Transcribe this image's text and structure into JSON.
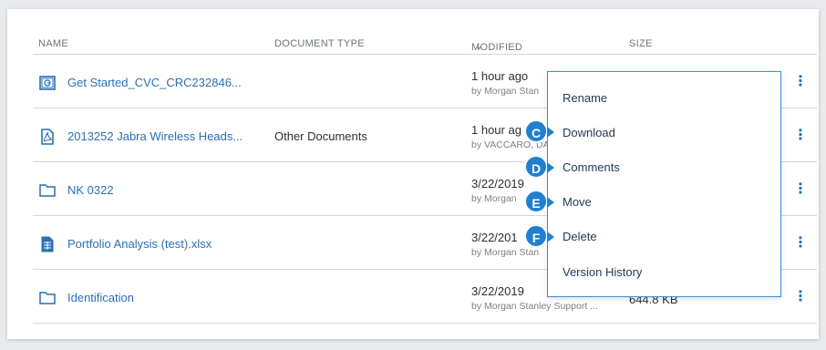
{
  "table": {
    "headers": {
      "name": "NAME",
      "document_type": "DOCUMENT TYPE",
      "modified": "MODIFIED",
      "size": "SIZE"
    },
    "rows": [
      {
        "icon": "presentation-icon",
        "name": "Get Started_CVC_CRC232846...",
        "document_type": "",
        "modified": "1 hour ago",
        "by": "by Morgan Stan",
        "size": ""
      },
      {
        "icon": "pdf-icon",
        "name": "2013252 Jabra Wireless Heads...",
        "document_type": "Other Documents",
        "modified": "1 hour ag",
        "by": "by VACCARO, DAN",
        "size": ""
      },
      {
        "icon": "folder-icon",
        "name": "NK 0322",
        "document_type": "",
        "modified": "3/22/2019",
        "by": "by Morgan",
        "size": ""
      },
      {
        "icon": "spreadsheet-icon",
        "name": "Portfolio Analysis (test).xlsx",
        "document_type": "",
        "modified": "3/22/201",
        "by": "by Morgan Stan",
        "size": ""
      },
      {
        "icon": "folder-icon",
        "name": "Identification",
        "document_type": "",
        "modified": "3/22/2019",
        "by": "by Morgan Stanley Support ...",
        "size": "644.8 KB"
      }
    ],
    "more_glyph": "⋮"
  },
  "context_menu": {
    "items": [
      "Rename",
      "Download",
      "Comments",
      "Move",
      "Delete",
      "Version History"
    ]
  },
  "markers": [
    "C",
    "D",
    "E",
    "F"
  ],
  "colors": {
    "link": "#2a6fb4",
    "marker": "#1f7fd1",
    "menu_border": "#3a8fd6"
  }
}
